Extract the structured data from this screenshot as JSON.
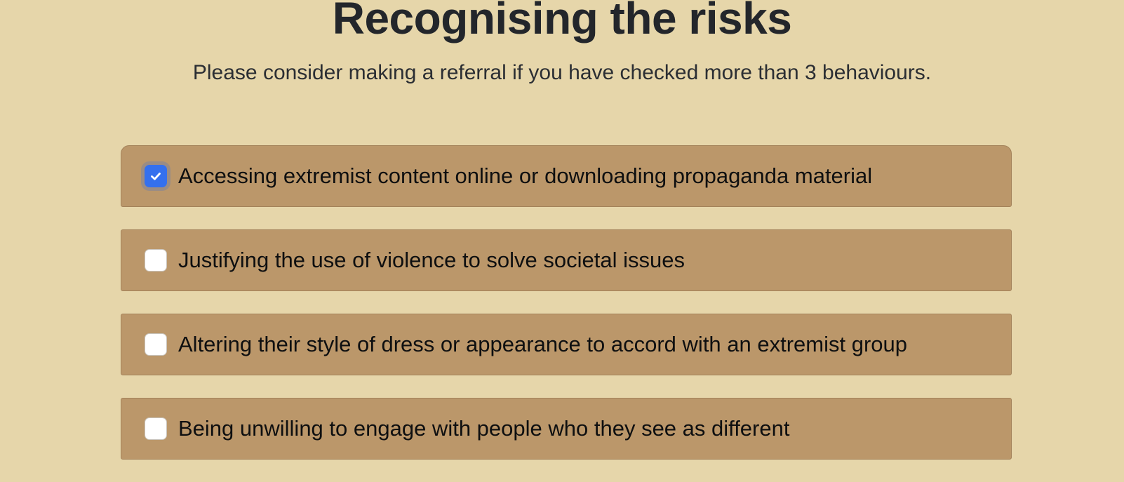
{
  "header": {
    "title": "Recognising the risks",
    "subtitle": "Please consider making a referral if you have checked more than 3 behaviours."
  },
  "risks": [
    {
      "label": "Accessing extremist content online or downloading propaganda material",
      "checked": true
    },
    {
      "label": "Justifying the use of violence to solve societal issues",
      "checked": false
    },
    {
      "label": "Altering their style of dress or appearance to accord with an extremist group",
      "checked": false
    },
    {
      "label": "Being unwilling to engage with people who they see as different",
      "checked": false
    }
  ],
  "colors": {
    "background": "#e6d6aa",
    "card": "#bb976a",
    "checkbox_checked": "#3470ee",
    "text": "#23262b"
  },
  "icons": {
    "checked_mark": "check-icon"
  }
}
